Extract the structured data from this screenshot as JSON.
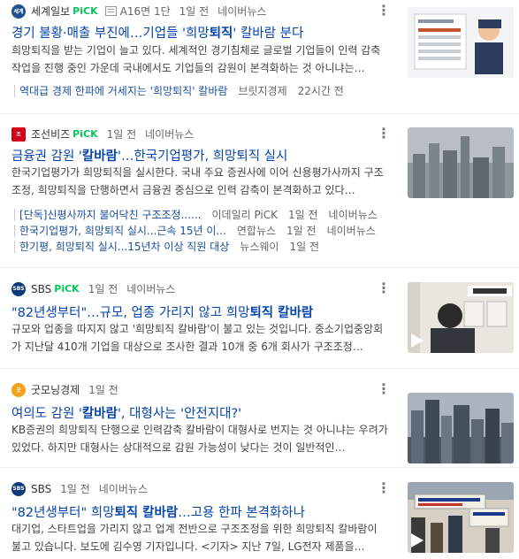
{
  "articles": [
    {
      "press": "세계일보",
      "pick": "PiCK",
      "paper_page": "A16면 1단",
      "time": "1일 전",
      "source_link": "네이버뉴스",
      "title_pre": "경기 불황·매출 부진에…기업들 '희망",
      "title_bold": "퇴직",
      "title_post": "' 칼바람 분다",
      "desc": "희망퇴직을 받는 기업이 늘고 있다. 세계적인 경기침체로 글로벌 기업들이 인력 감축 작업을 진행 중인 가운데 국내에서도 기업들의 감원이 본격화하는 것 아니냐는…",
      "related": [
        {
          "text": "역대급 경제 한파에 거세지는 '희망퇴직' 칼바람",
          "press": "브릿지경제",
          "time": "22시간 전"
        }
      ]
    },
    {
      "press": "조선비즈",
      "pick": "PiCK",
      "time": "1일 전",
      "source_link": "네이버뉴스",
      "title_pre": "금융권 감원 '",
      "title_bold": "칼바람",
      "title_post": "'…한국기업평가, 희망퇴직 실시",
      "desc": "한국기업평가가 희망퇴직을 실시한다. 국내 주요 증권사에 이어 신용평가사까지 구조조정, 희망퇴직을 단행하면서 금융권 중심으로 인력 감축이 본격화하고 있다…",
      "related": [
        {
          "text": "[단독]신평사까지 불어닥친 구조조정......",
          "press": "이데일리 PiCK",
          "time": "1일 전",
          "link": "네이버뉴스"
        },
        {
          "text": "한국기업평가, 희망퇴직 실시...근속 15년 이...",
          "press": "연합뉴스",
          "time": "1일 전",
          "link": "네이버뉴스"
        },
        {
          "text": "한기평, 희망퇴직 실시...15년차 이상 직원 대상",
          "press": "뉴스웨이",
          "time": "1일 전"
        }
      ]
    },
    {
      "press": "SBS",
      "pick": "PiCK",
      "time": "1일 전",
      "source_link": "네이버뉴스",
      "title_pre": "\"82년생부터\"…규모, 업종 가리지 않고 희망",
      "title_bold": "퇴직 칼바람",
      "title_post": "",
      "desc": "규모와 업종을 따지지 않고 '희망퇴직 칼바람'이 불고 있는 것입니다. 중소기업중앙회가 지난달 410개 기업을 대상으로 조사한 결과 10개 중 6개 회사가 구조조정…"
    },
    {
      "press": "굿모닝경제",
      "time": "1일 전",
      "title_pre": "여의도 감원 '",
      "title_bold": "칼바람",
      "title_post": "', 대형사는 '안전지대?'",
      "desc": "KB증권의 희망퇴직 단행으로 인력감축 칼바람이 대형사로 번지는 것 아니냐는 우려가 있었다. 하지만 대형사는 상대적으로 감원 가능성이 낮다는 것이 일반적인…"
    },
    {
      "press": "SBS",
      "time": "1일 전",
      "source_link": "네이버뉴스",
      "title_pre": "\"82년생부터\" 희망",
      "title_bold": "퇴직 칼바람",
      "title_post": "…고용 한파 본격화하나",
      "desc": "대기업, 스타트업을 가리지 않고 업계 전반으로 구조조정을 위한 희망퇴직 칼바람이 불고 있습니다. 보도에 김수영 기자입니다. <기자> 지난 7일, LG전자 제품을…"
    }
  ],
  "colors": {
    "link": "#0645ad",
    "pick": "#03c75a"
  }
}
